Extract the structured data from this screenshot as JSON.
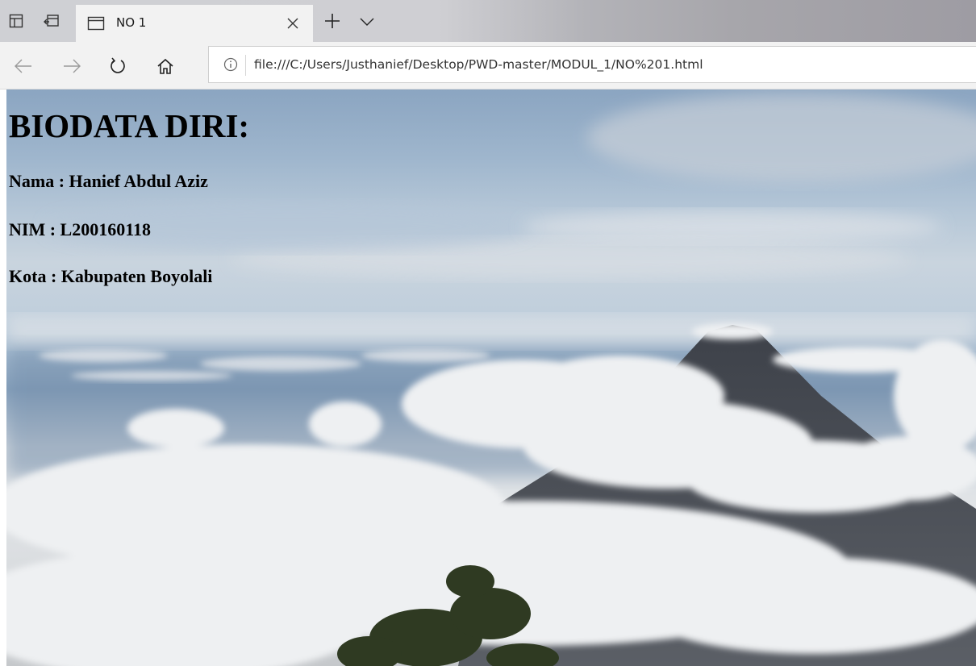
{
  "browser": {
    "tab": {
      "title": "NO 1"
    },
    "address_bar": {
      "url": "file:///C:/Users/Justhanief/Desktop/PWD-master/MODUL_1/NO%201.html"
    },
    "icons": [
      "set-aside-tabs-icon",
      "restore-tabs-icon",
      "page-icon",
      "close-icon",
      "new-tab-icon",
      "chevron-down-icon",
      "back-icon",
      "forward-icon",
      "refresh-icon",
      "home-icon",
      "info-icon"
    ]
  },
  "page": {
    "heading": "BIODATA DIRI:",
    "fields": [
      {
        "text": "Nama : Hanief Abdul Aziz"
      },
      {
        "text": "NIM : L200160118"
      },
      {
        "text": "Kota : Kabupaten Boyolali"
      }
    ],
    "background": "mountain-above-clouds-photo"
  }
}
